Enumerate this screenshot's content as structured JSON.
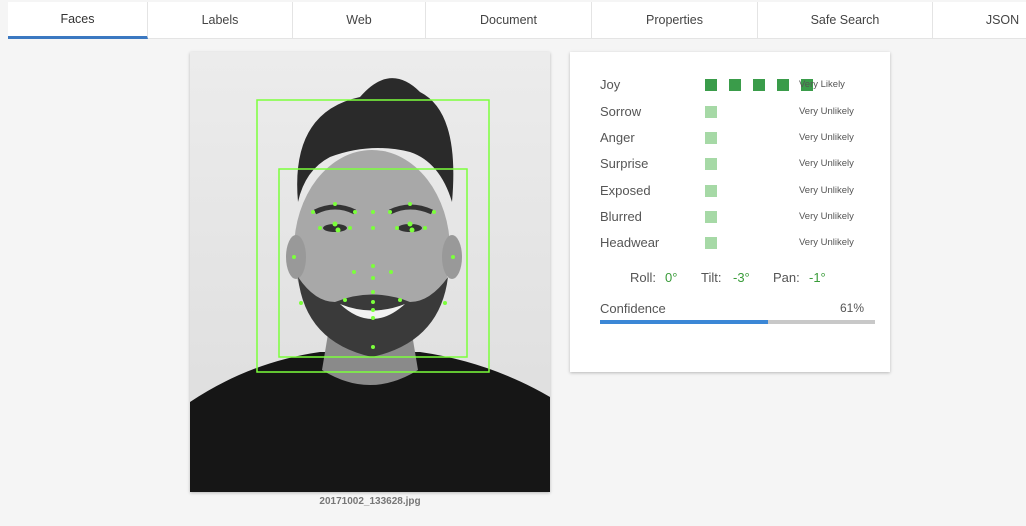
{
  "tabs": [
    {
      "label": "Faces",
      "active": true
    },
    {
      "label": "Labels"
    },
    {
      "label": "Web"
    },
    {
      "label": "Document"
    },
    {
      "label": "Properties"
    },
    {
      "label": "Safe Search"
    },
    {
      "label": "JSON"
    }
  ],
  "image": {
    "filename": "20171002_133628.jpg"
  },
  "emotions": [
    {
      "label": "Joy",
      "likelihood": "Very Likely",
      "level": 5
    },
    {
      "label": "Sorrow",
      "likelihood": "Very Unlikely",
      "level": 1
    },
    {
      "label": "Anger",
      "likelihood": "Very Unlikely",
      "level": 1
    },
    {
      "label": "Surprise",
      "likelihood": "Very Unlikely",
      "level": 1
    },
    {
      "label": "Exposed",
      "likelihood": "Very Unlikely",
      "level": 1
    },
    {
      "label": "Blurred",
      "likelihood": "Very Unlikely",
      "level": 1
    },
    {
      "label": "Headwear",
      "likelihood": "Very Unlikely",
      "level": 1
    }
  ],
  "angles": {
    "roll_label": "Roll:",
    "roll": "0°",
    "tilt_label": "Tilt:",
    "tilt": "-3°",
    "pan_label": "Pan:",
    "pan": "-1°"
  },
  "confidence": {
    "label": "Confidence",
    "value_text": "61%",
    "fraction": 0.61
  },
  "colors": {
    "accent": "#3b78c1",
    "box_strong": "#3a9c4a",
    "box_weak": "#a6d9a6",
    "landmark": "#7cff3c",
    "bar": "#3b87d6"
  }
}
